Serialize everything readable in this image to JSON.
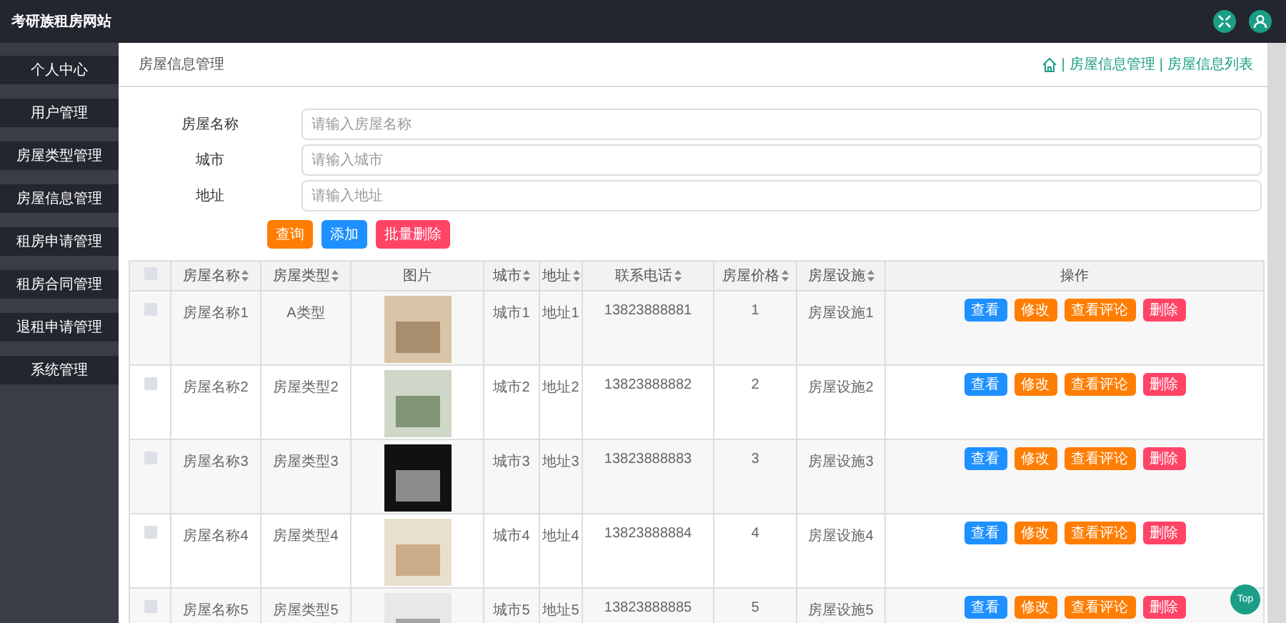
{
  "app": {
    "title": "考研族租房网站"
  },
  "sidebar": {
    "items": [
      {
        "label": "个人中心",
        "selected": false
      },
      {
        "label": "用户管理",
        "selected": false
      },
      {
        "label": "房屋类型管理",
        "selected": false
      },
      {
        "label": "房屋信息管理",
        "selected": false
      },
      {
        "label": "租房申请管理",
        "selected": false
      },
      {
        "label": "租房合同管理",
        "selected": false
      },
      {
        "label": "退租申请管理",
        "selected": false
      },
      {
        "label": "系统管理",
        "selected": false
      }
    ]
  },
  "page": {
    "title": "房屋信息管理",
    "breadcrumb": {
      "separator": "|",
      "items": [
        "房屋信息管理",
        "房屋信息列表"
      ]
    }
  },
  "search_form": {
    "fields": [
      {
        "label": "房屋名称",
        "placeholder": "请输入房屋名称"
      },
      {
        "label": "城市",
        "placeholder": "请输入城市"
      },
      {
        "label": "地址",
        "placeholder": "请输入地址"
      }
    ],
    "buttons": [
      {
        "label": "查询",
        "kind": "search"
      },
      {
        "label": "添加",
        "kind": "add"
      },
      {
        "label": "批量删除",
        "kind": "delete"
      }
    ]
  },
  "table": {
    "select_all": {
      "checked": false
    },
    "columns": [
      {
        "label": "房屋名称",
        "sortable": true
      },
      {
        "label": "房屋类型",
        "sortable": true
      },
      {
        "label": "图片",
        "sortable": false
      },
      {
        "label": "城市",
        "sortable": true
      },
      {
        "label": "地址",
        "sortable": true
      },
      {
        "label": "联系电话",
        "sortable": true
      },
      {
        "label": "房屋价格",
        "sortable": true
      },
      {
        "label": "房屋设施",
        "sortable": true
      },
      {
        "label": "操作",
        "sortable": false
      }
    ],
    "rows": [
      {
        "checked": false,
        "name": "房屋名称1",
        "type": "A类型",
        "city": "城市1",
        "address": "地址1",
        "phone": "13823888881",
        "price": "1",
        "facilities": "房屋设施1",
        "actions": [
          {
            "label": "查看",
            "kind": "view"
          },
          {
            "label": "修改",
            "kind": "edit"
          },
          {
            "label": "查看评论",
            "kind": "comments"
          },
          {
            "label": "删除",
            "kind": "delete"
          }
        ]
      },
      {
        "checked": false,
        "name": "房屋名称2",
        "type": "房屋类型2",
        "city": "城市2",
        "address": "地址2",
        "phone": "13823888882",
        "price": "2",
        "facilities": "房屋设施2",
        "actions": [
          {
            "label": "查看",
            "kind": "view"
          },
          {
            "label": "修改",
            "kind": "edit"
          },
          {
            "label": "查看评论",
            "kind": "comments"
          },
          {
            "label": "删除",
            "kind": "delete"
          }
        ]
      },
      {
        "checked": false,
        "name": "房屋名称3",
        "type": "房屋类型3",
        "city": "城市3",
        "address": "地址3",
        "phone": "13823888883",
        "price": "3",
        "facilities": "房屋设施3",
        "actions": [
          {
            "label": "查看",
            "kind": "view"
          },
          {
            "label": "修改",
            "kind": "edit"
          },
          {
            "label": "查看评论",
            "kind": "comments"
          },
          {
            "label": "删除",
            "kind": "delete"
          }
        ]
      },
      {
        "checked": false,
        "name": "房屋名称4",
        "type": "房屋类型4",
        "city": "城市4",
        "address": "地址4",
        "phone": "13823888884",
        "price": "4",
        "facilities": "房屋设施4",
        "actions": [
          {
            "label": "查看",
            "kind": "view"
          },
          {
            "label": "修改",
            "kind": "edit"
          },
          {
            "label": "查看评论",
            "kind": "comments"
          },
          {
            "label": "删除",
            "kind": "delete"
          }
        ]
      },
      {
        "checked": false,
        "name": "房屋名称5",
        "type": "房屋类型5",
        "city": "城市5",
        "address": "地址5",
        "phone": "13823888885",
        "price": "5",
        "facilities": "房屋设施5",
        "actions": [
          {
            "label": "查看",
            "kind": "view"
          },
          {
            "label": "修改",
            "kind": "edit"
          },
          {
            "label": "查看评论",
            "kind": "comments"
          },
          {
            "label": "删除",
            "kind": "delete"
          }
        ]
      }
    ]
  },
  "back_to_top": {
    "label": "Top"
  }
}
